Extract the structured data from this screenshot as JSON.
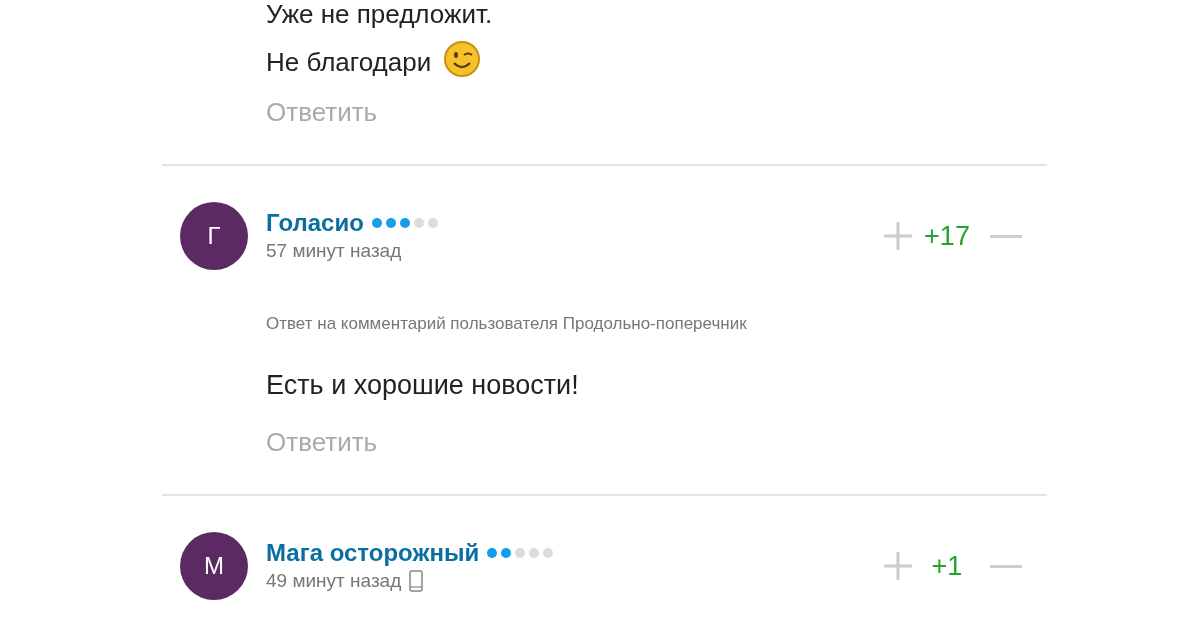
{
  "top_comment": {
    "paragraphs": [
      {
        "text": "Уже не предложит."
      },
      {
        "text": "Не благодари",
        "emoji": true
      }
    ],
    "reply": "Ответить"
  },
  "comments": [
    {
      "avatar": "Г",
      "name": "Голасио",
      "stars": 3,
      "time": "57 минут назад",
      "mobile": false,
      "score": "+17",
      "reply_to": {
        "prefix": "Ответ на",
        "link": "комментарий",
        "middle": "пользователя",
        "user": "Продольно-поперечник"
      },
      "body": "Есть и хорошие новости!",
      "reply": "Ответить"
    },
    {
      "avatar": "М",
      "name": "Мага осторожный",
      "stars": 2,
      "time": "49 минут назад",
      "mobile": true,
      "score": "+1"
    }
  ]
}
